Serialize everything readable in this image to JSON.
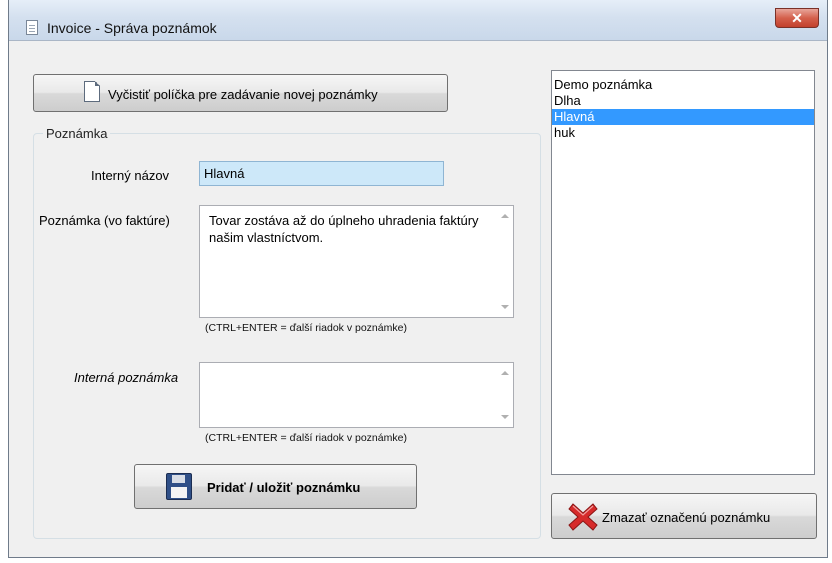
{
  "window": {
    "title": "Invoice - Správa poznámok",
    "close_glyph": "✕"
  },
  "toolbar": {
    "clear_label": "Vyčistiť políčka pre zadávanie novej poznámky",
    "clear_icon": "document-icon"
  },
  "group": {
    "title": "Poznámka"
  },
  "fields": {
    "internal_name_label": "Interný názov",
    "internal_name_value": "Hlavná",
    "note_label": "Poznámka (vo faktúre)",
    "note_value": "Tovar zostáva až do úplneho uhradenia faktúry našim vlastníctvom.",
    "note_hint": "(CTRL+ENTER = ďalší riadok v poznámke)",
    "internal_note_label": "Interná poznámka",
    "internal_note_value": "",
    "internal_note_hint": "(CTRL+ENTER = ďalší riadok v poznámke)"
  },
  "save_button": {
    "label": "Pridať / uložiť poznámku",
    "icon": "floppy-disk-icon"
  },
  "list": {
    "items": [
      {
        "label": "Demo poznámka",
        "selected": false
      },
      {
        "label": "Dlha",
        "selected": false
      },
      {
        "label": "Hlavná",
        "selected": true
      },
      {
        "label": "huk",
        "selected": false
      }
    ]
  },
  "delete_button": {
    "label": "Zmazať označenú poznámku",
    "icon": "red-x-icon"
  },
  "colors": {
    "selection": "#3399ff",
    "input_highlight": "#cde8f9"
  }
}
